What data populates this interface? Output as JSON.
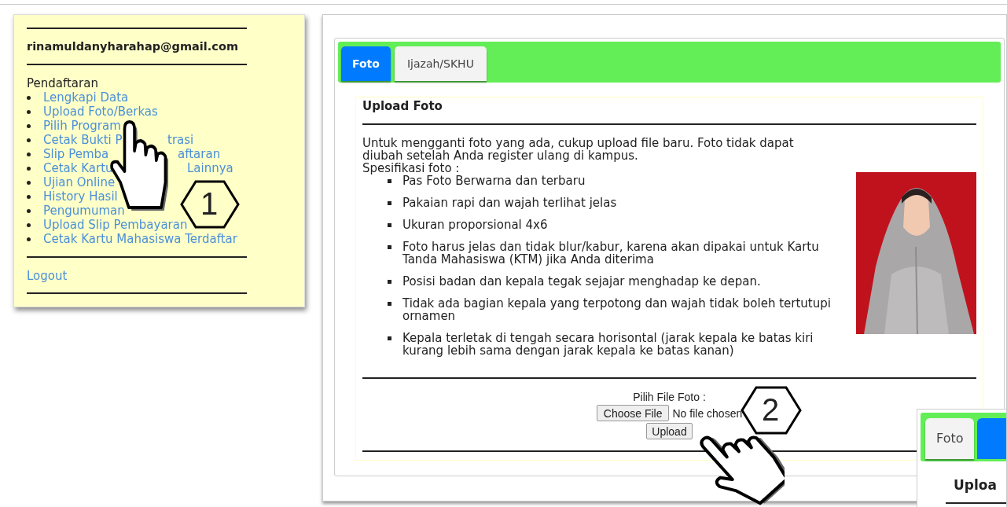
{
  "account": {
    "email": "rinamuldanyharahap@gmail.com"
  },
  "menu": {
    "heading": "Pendaftaran",
    "items": [
      {
        "label": "Lengkapi Data"
      },
      {
        "label": "Upload Foto/Berkas"
      },
      {
        "label": "Pilih Program"
      },
      {
        "label": "Cetak Bukti P",
        "tail": "trasi"
      },
      {
        "label": "Slip Pemba",
        "tail": "aftaran"
      },
      {
        "label": "Cetak Kartu",
        "tail": "Lainnya"
      },
      {
        "label": "Ujian Online"
      },
      {
        "label": "History Hasil"
      },
      {
        "label": "Pengumuman"
      },
      {
        "label": "Upload Slip Pembayaran"
      },
      {
        "label": "Cetak Kartu Mahasiswa Terdaftar"
      }
    ],
    "logout": "Logout"
  },
  "tabs": [
    {
      "label": "Foto",
      "selected": true
    },
    {
      "label": "Ijazah/SKHU",
      "selected": false
    }
  ],
  "panel": {
    "title": "Upload Foto",
    "intro": "Untuk mengganti foto yang ada, cukup upload file baru. Foto tidak dapat diubah setelah Anda register ulang di kampus.",
    "spec_heading": "Spesifikasi foto :",
    "specs": [
      "Pas Foto Berwarna dan terbaru",
      "Pakaian rapi dan wajah terlihat jelas",
      "Ukuran proporsional 4x6",
      "Foto harus jelas dan tidak blur/kabur, karena akan dipakai untuk Kartu Tanda Mahasiswa (KTM) jika Anda diterima",
      "Posisi badan dan kepala tegak sejajar menghadap ke depan.",
      "Tidak ada bagian kepala yang terpotong dan wajah tidak boleh tertutupi ornamen",
      "Kepala terletak di tengah secara horisontal (jarak kepala ke batas kiri kurang lebih sama dengan jarak kepala ke batas kanan)"
    ],
    "upload": {
      "label": "Pilih File Foto :",
      "choose_button": "Choose File",
      "file_status": "No file chosen",
      "submit": "Upload"
    }
  },
  "annotations": [
    {
      "number": "1"
    },
    {
      "number": "2"
    }
  ],
  "inset": {
    "tabs": [
      {
        "label": "Foto",
        "selected": false
      },
      {
        "selected": true
      }
    ],
    "heading": "Uploa"
  }
}
